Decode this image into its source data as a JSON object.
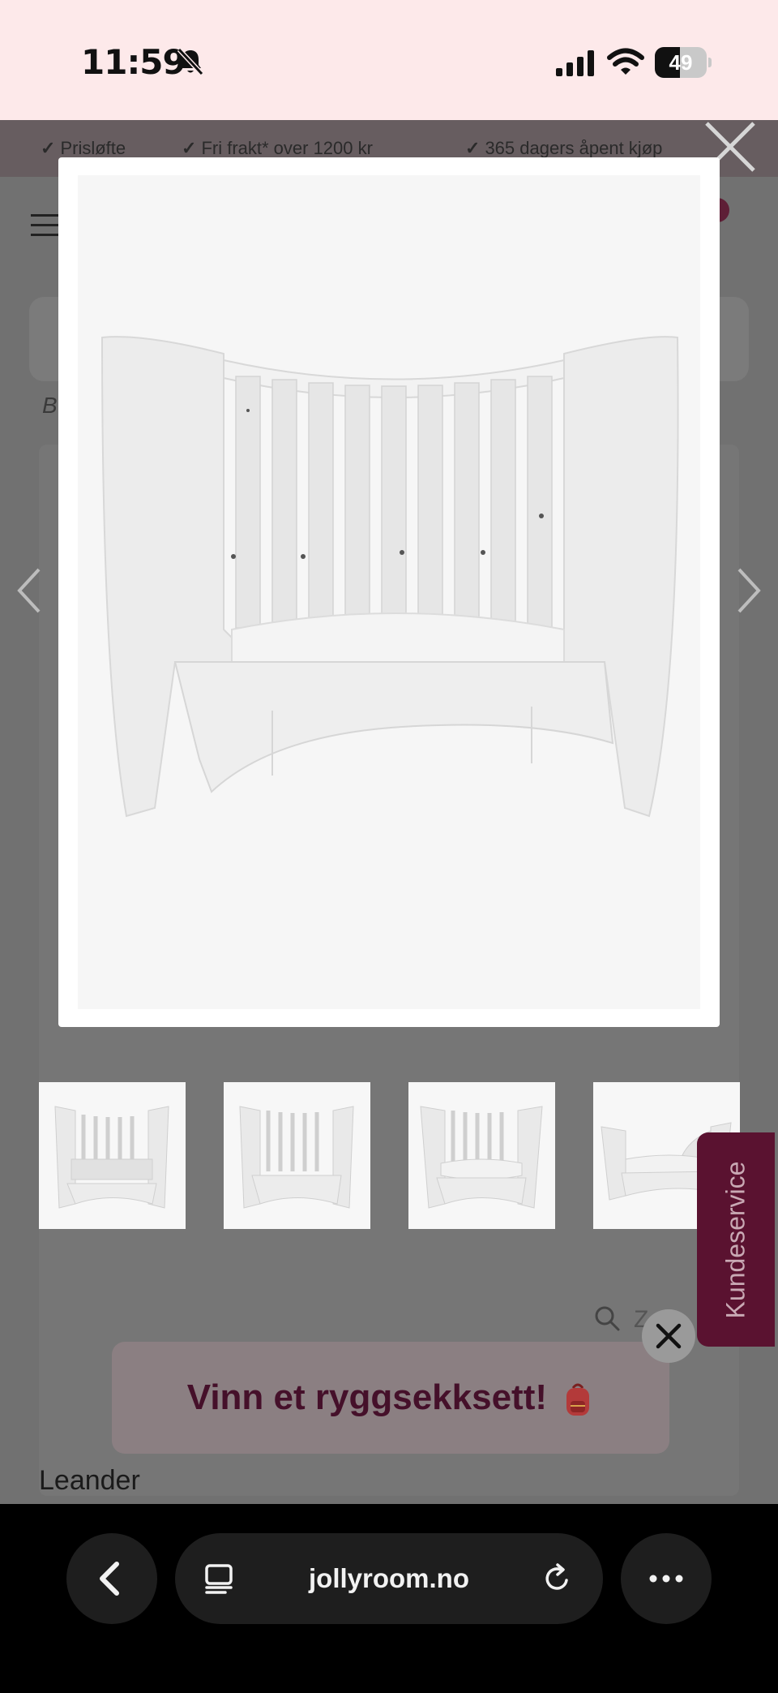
{
  "status_bar": {
    "time": "11:59",
    "battery_percent": 49,
    "battery_label": "49"
  },
  "page": {
    "usp_items": [
      "Prisløfte",
      "Fri frakt* over 1200 kr",
      "365 dagers åpent kjøp"
    ],
    "breadcrumb_stub": "B",
    "zoom_label": "Z",
    "product_name": "Leander"
  },
  "lightbox": {
    "image_alt": "White Leander baby cot converted to junior bed",
    "thumbnails": [
      "cot-with-mattress",
      "cot-open-front",
      "cot-low",
      "junior-bed"
    ]
  },
  "customer_service": {
    "label": "Kundeservice"
  },
  "promo": {
    "text": "Vinn et ryggsekksett!",
    "icon": "backpack-icon"
  },
  "browser": {
    "url": "jollyroom.no"
  },
  "colors": {
    "status_bg": "#fde9ea",
    "brand_plum": "#5a1230",
    "promo_text": "#45102a"
  }
}
